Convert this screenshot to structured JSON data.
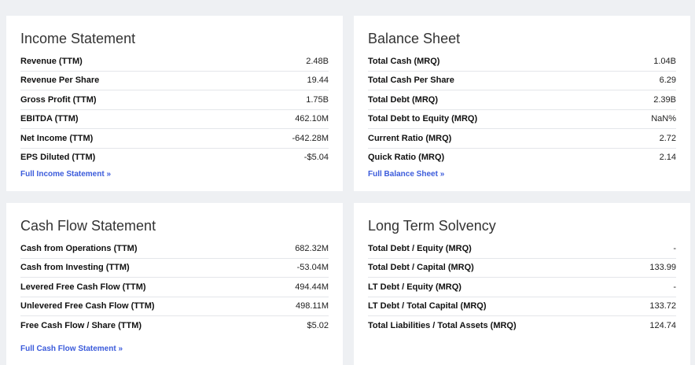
{
  "income": {
    "title": "Income Statement",
    "rows": [
      {
        "label": "Revenue (TTM)",
        "value": "2.48B"
      },
      {
        "label": "Revenue Per Share",
        "value": "19.44"
      },
      {
        "label": "Gross Profit (TTM)",
        "value": "1.75B"
      },
      {
        "label": "EBITDA (TTM)",
        "value": "462.10M"
      },
      {
        "label": "Net Income (TTM)",
        "value": "-642.28M"
      },
      {
        "label": "EPS Diluted (TTM)",
        "value": "-$5.04"
      }
    ],
    "link": "Full Income Statement »"
  },
  "balance": {
    "title": "Balance Sheet",
    "rows": [
      {
        "label": "Total Cash (MRQ)",
        "value": "1.04B"
      },
      {
        "label": "Total Cash Per Share",
        "value": "6.29"
      },
      {
        "label": "Total Debt (MRQ)",
        "value": "2.39B"
      },
      {
        "label": "Total Debt to Equity (MRQ)",
        "value": "NaN%"
      },
      {
        "label": "Current Ratio (MRQ)",
        "value": "2.72"
      },
      {
        "label": "Quick Ratio (MRQ)",
        "value": "2.14"
      }
    ],
    "link": "Full Balance Sheet »"
  },
  "cashflow": {
    "title": "Cash Flow Statement",
    "rows": [
      {
        "label": "Cash from Operations (TTM)",
        "value": "682.32M"
      },
      {
        "label": "Cash from Investing (TTM)",
        "value": "-53.04M"
      },
      {
        "label": "Levered Free Cash Flow (TTM)",
        "value": "494.44M"
      },
      {
        "label": "Unlevered Free Cash Flow (TTM)",
        "value": "498.11M"
      },
      {
        "label": "Free Cash Flow / Share (TTM)",
        "value": "$5.02"
      }
    ],
    "link": "Full Cash Flow Statement »"
  },
  "solvency": {
    "title": "Long Term Solvency",
    "rows": [
      {
        "label": "Total Debt / Equity (MRQ)",
        "value": "-"
      },
      {
        "label": "Total Debt / Capital (MRQ)",
        "value": "133.99"
      },
      {
        "label": "LT Debt / Equity (MRQ)",
        "value": "-"
      },
      {
        "label": "LT Debt / Total Capital (MRQ)",
        "value": "133.72"
      },
      {
        "label": "Total Liabilities / Total Assets (MRQ)",
        "value": "124.74"
      }
    ]
  }
}
